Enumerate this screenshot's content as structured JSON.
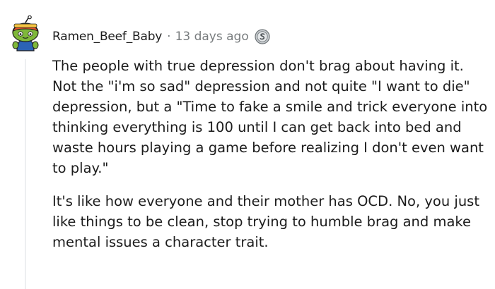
{
  "comment": {
    "username": "Ramen_Beef_Baby",
    "separator": "·",
    "timestamp": "13 days ago",
    "award_icon": "silver-award-icon",
    "avatar_icon": "snoo-avatar-icon",
    "paragraphs": [
      "The people with true depression don't brag about having it. Not the \"i'm so sad\" depression and not quite \"I want to die\" depression, but a \"Time to fake a smile and trick everyone into thinking everything is 100 until I can get back into bed and waste hours playing a game before realizing I don't even want to play.\"",
      "It's like how everyone and their mother has OCD. No, you just like things to be clean, stop trying to humble brag and make mental issues a character trait."
    ]
  },
  "colors": {
    "text": "#1c1c1c",
    "meta": "#787c7e",
    "thread_line": "#edeff1",
    "avatar_skin": "#7fb83a",
    "avatar_hat": "#e8552c",
    "avatar_body": "#2b63b5"
  }
}
